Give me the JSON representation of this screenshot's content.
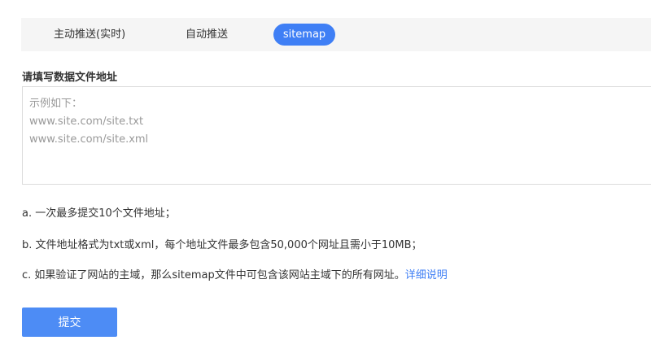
{
  "tabs": [
    {
      "label": "主动推送(实时)",
      "active": false
    },
    {
      "label": "自动推送",
      "active": false
    },
    {
      "label": "sitemap",
      "active": true
    }
  ],
  "form": {
    "label": "请填写数据文件地址",
    "placeholder": "示例如下：\nwww.site.com/site.txt\nwww.site.com/site.xml"
  },
  "notes": {
    "a": "a. 一次最多提交10个文件地址；",
    "b": "b. 文件地址格式为txt或xml，每个地址文件最多包含50,000个网址且需小于10MB；",
    "c": "c. 如果验证了网站的主域，那么sitemap文件中可包含该网站主域下的所有网址。",
    "c_link": "详细说明"
  },
  "submit_label": "提交",
  "colors": {
    "accent": "#3f7ff5",
    "tabbar_bg": "#f5f5f5"
  }
}
